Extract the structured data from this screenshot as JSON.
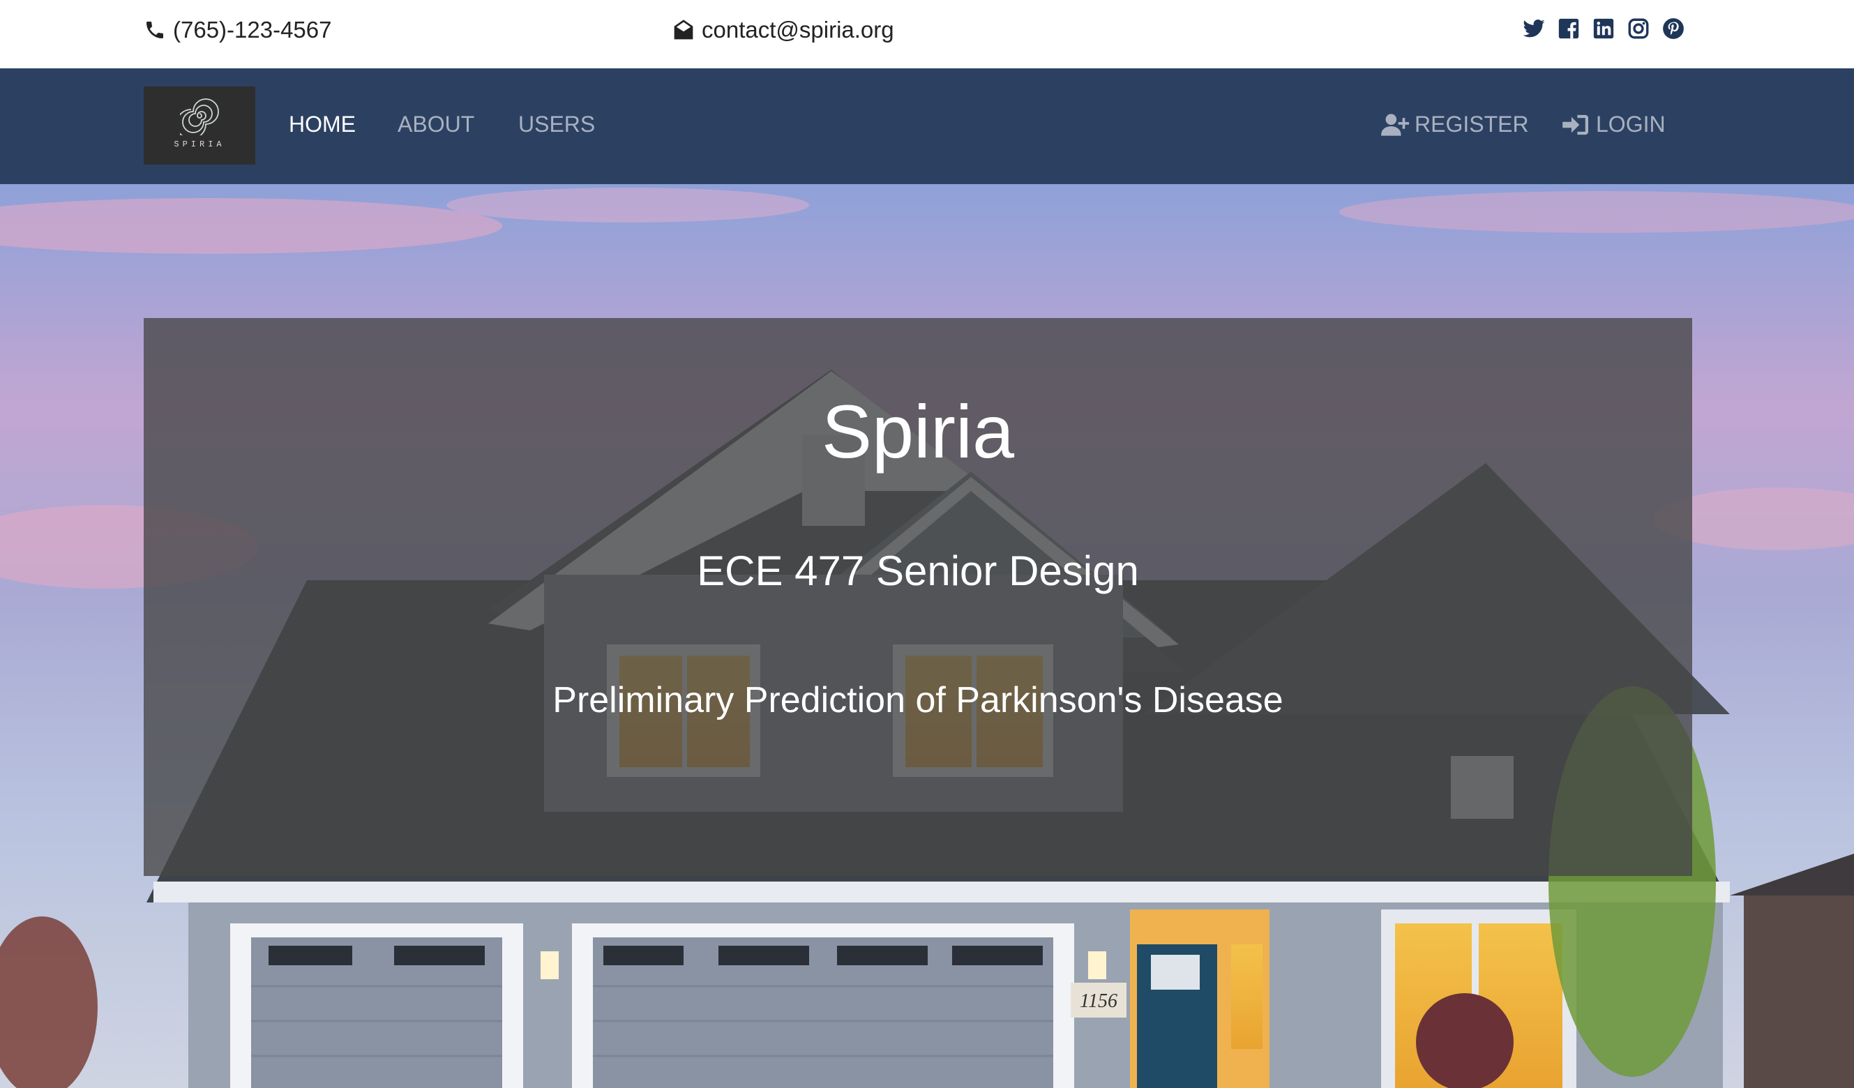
{
  "topbar": {
    "phone": "(765)-123-4567",
    "email": "contact@spiria.org",
    "social_icons": [
      "twitter-icon",
      "facebook-icon",
      "linkedin-icon",
      "instagram-icon",
      "pinterest-icon"
    ]
  },
  "navbar": {
    "logo_text": "SPIRIA",
    "links": [
      {
        "label": "HOME",
        "active": true
      },
      {
        "label": "ABOUT",
        "active": false
      },
      {
        "label": "USERS",
        "active": false
      }
    ],
    "register_label": "REGISTER",
    "login_label": "LOGIN",
    "background": "#2c4162"
  },
  "hero": {
    "title": "Spiria",
    "course": "ECE 477 Senior Design",
    "subtitle": "Preliminary Prediction of Parkinson's Disease",
    "house_number": "1156"
  }
}
